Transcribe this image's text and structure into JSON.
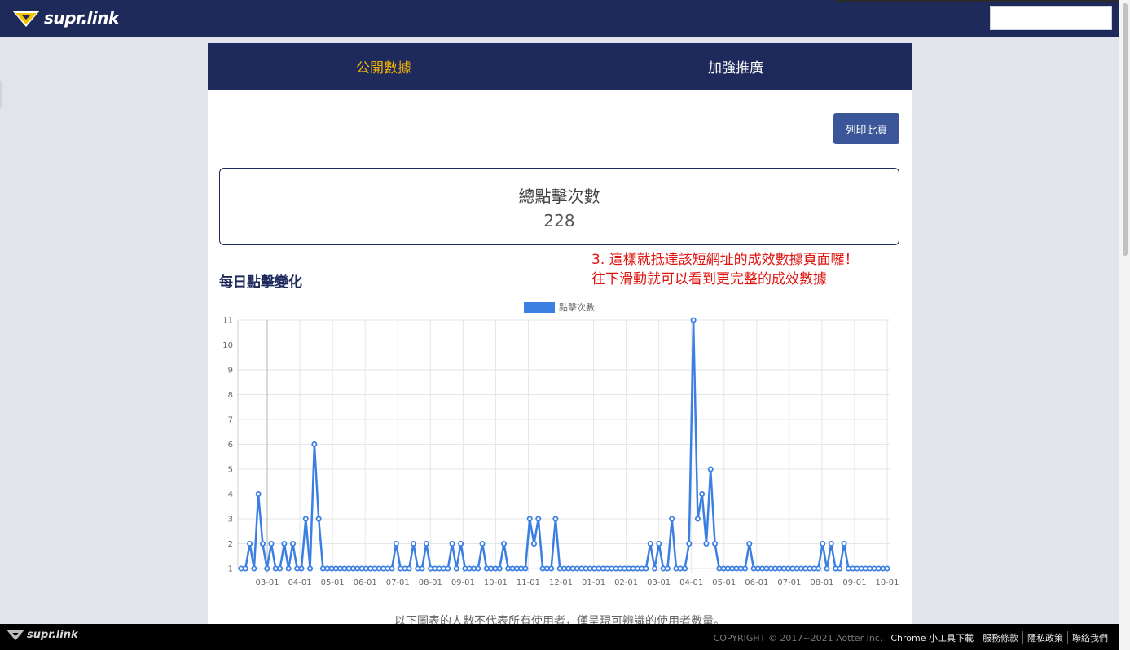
{
  "header": {
    "brand": "supr.link"
  },
  "tabs": [
    {
      "label": "公開數據",
      "active": true
    },
    {
      "label": "加強推廣",
      "active": false
    }
  ],
  "print_button": "列印此頁",
  "total_clicks": {
    "label": "總點擊次數",
    "value": "228"
  },
  "annotation": {
    "line1": "3. 這樣就抵達該短網址的成效數據頁面囉！",
    "line2": "往下滑動就可以看到更完整的成效數據"
  },
  "section_title": "每日點擊變化",
  "chart_data": {
    "type": "line",
    "legend": "點擊次數",
    "legend_position": "top",
    "color": "#3b7fe3",
    "grid": true,
    "ylim": [
      1,
      11
    ],
    "y_ticks": [
      1,
      2,
      3,
      4,
      5,
      6,
      7,
      8,
      9,
      10,
      11
    ],
    "x_tick_labels": [
      "03-01",
      "04-01",
      "05-01",
      "06-01",
      "07-01",
      "08-01",
      "09-01",
      "10-01",
      "11-01",
      "12-01",
      "01-01",
      "02-01",
      "03-01",
      "04-01",
      "05-01",
      "06-01",
      "07-01",
      "08-01",
      "09-01",
      "10-01"
    ],
    "series": [
      {
        "name": "點擊次數",
        "values": [
          1,
          1,
          2,
          1,
          4,
          2,
          1,
          2,
          1,
          1,
          2,
          1,
          2,
          1,
          1,
          3,
          1,
          6,
          3,
          1,
          1,
          1,
          1,
          1,
          1,
          1,
          1,
          1,
          1,
          1,
          1,
          1,
          1,
          1,
          1,
          1,
          2,
          1,
          1,
          1,
          2,
          1,
          1,
          2,
          1,
          1,
          1,
          1,
          1,
          2,
          1,
          2,
          1,
          1,
          1,
          1,
          2,
          1,
          1,
          1,
          1,
          2,
          1,
          1,
          1,
          1,
          1,
          3,
          2,
          3,
          1,
          1,
          1,
          3,
          1,
          1,
          1,
          1,
          1,
          1,
          1,
          1,
          1,
          1,
          1,
          1,
          1,
          1,
          1,
          1,
          1,
          1,
          1,
          1,
          1,
          2,
          1,
          2,
          1,
          1,
          3,
          1,
          1,
          1,
          2,
          11,
          3,
          4,
          2,
          5,
          2,
          1,
          1,
          1,
          1,
          1,
          1,
          1,
          2,
          1,
          1,
          1,
          1,
          1,
          1,
          1,
          1,
          1,
          1,
          1,
          1,
          1,
          1,
          1,
          1,
          2,
          1,
          2,
          1,
          1,
          2,
          1,
          1,
          1,
          1,
          1,
          1,
          1,
          1,
          1,
          1
        ]
      }
    ]
  },
  "footnote": "以下圖表的人數不代表所有使用者，僅呈現可辨識的使用者數量。",
  "footer": {
    "brand": "supr.link",
    "copyright": "COPYRIGHT © 2017~2021 Aotter Inc.",
    "links": [
      "Chrome 小工具下載",
      "服務條款",
      "隱私政策",
      "聯絡我們"
    ]
  }
}
